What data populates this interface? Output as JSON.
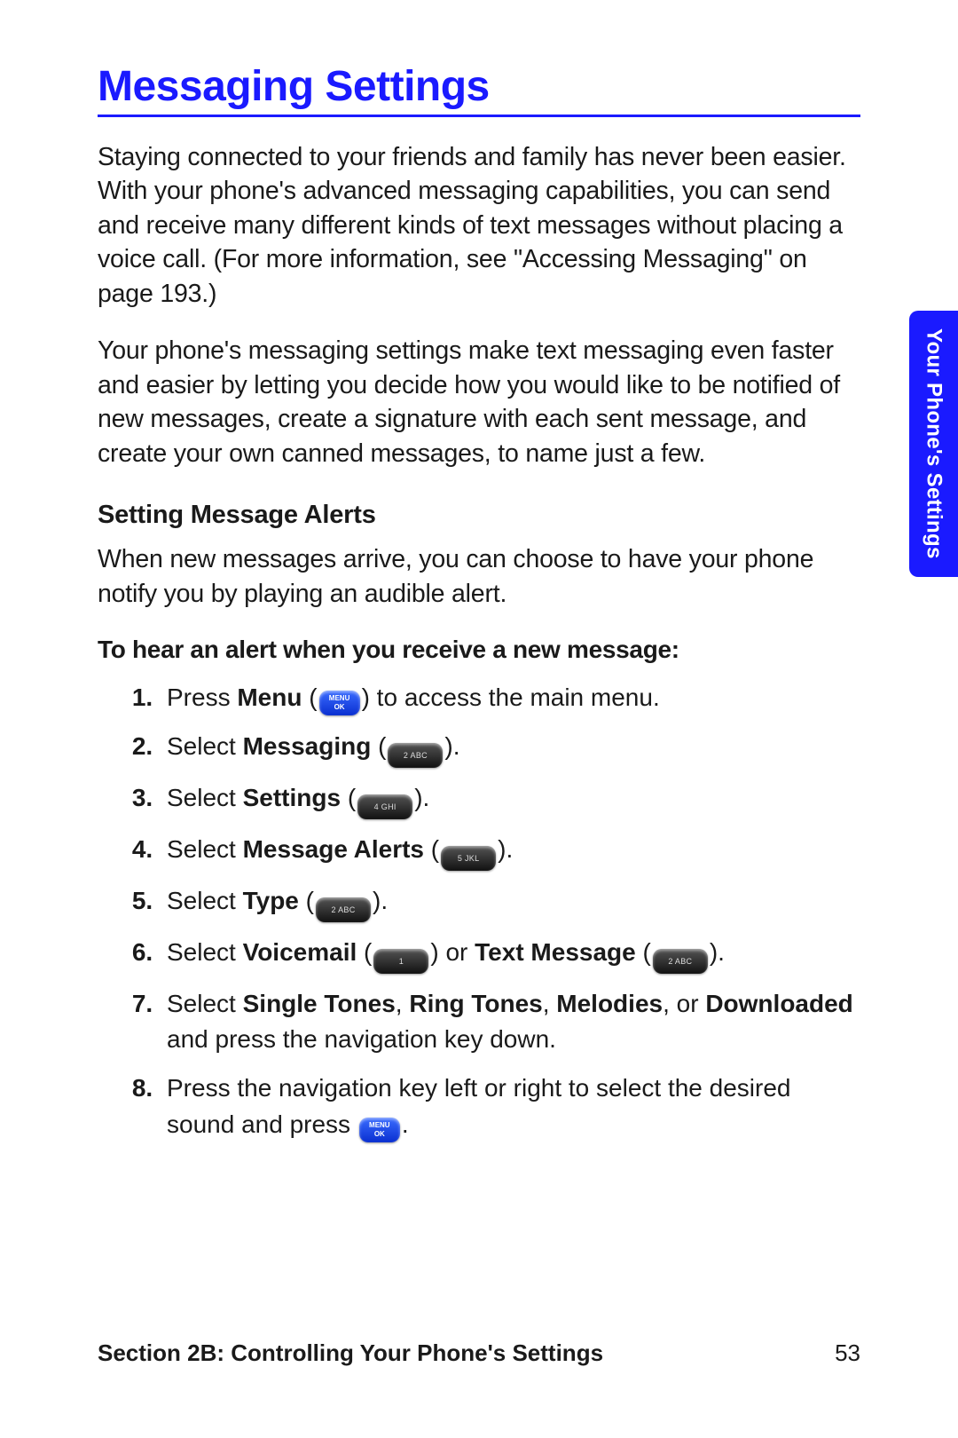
{
  "title": "Messaging Settings",
  "intro1": "Staying connected to your friends and family has never been easier. With your phone's advanced messaging capabilities, you can send and receive many different kinds of text messages without placing a voice call. (For more information, see \"Accessing Messaging\" on page 193.)",
  "intro2": "Your phone's messaging settings make text messaging even faster and easier by letting you decide how you would like to be notified of new messages, create a signature with each sent message, and create your own canned messages, to name just a few.",
  "subheading": "Setting Message Alerts",
  "sub_para": "When new messages arrive, you can choose to have your phone notify you by playing an audible alert.",
  "lead_in": "To hear an alert when you receive a new message:",
  "steps": {
    "s1a": "Press ",
    "s1b": "Menu",
    "s1c": " (",
    "s1d": ") to access the main menu.",
    "s2a": "Select ",
    "s2b": "Messaging",
    "s2c": " (",
    "s2d": ").",
    "s3a": "Select ",
    "s3b": "Settings",
    "s3c": " (",
    "s3d": ").",
    "s4a": "Select ",
    "s4b": "Message Alerts",
    "s4c": " (",
    "s4d": ").",
    "s5a": "Select ",
    "s5b": "Type",
    "s5c": " (",
    "s5d": ").",
    "s6a": "Select ",
    "s6b": "Voicemail",
    "s6c": " (",
    "s6d": ") or ",
    "s6e": "Text Message",
    "s6f": " (",
    "s6g": ").",
    "s7a": "Select ",
    "s7b": "Single Tones",
    "s7c": ", ",
    "s7d": "Ring Tones",
    "s7e": ", ",
    "s7f": "Melodies",
    "s7g": ", or ",
    "s7h": "Downloaded",
    "s7i": " and press the navigation key down.",
    "s8a": "Press the navigation key left or right to select the desired sound and press ",
    "s8b": "."
  },
  "keys": {
    "menu_line1": "MENU",
    "menu_line2": "OK",
    "k1": "1",
    "k2": "2 ABC",
    "k4": "4 GHI",
    "k5": "5 JKL"
  },
  "sidetab": "Your Phone's Settings",
  "footer": {
    "section": "Section 2B: Controlling Your Phone's Settings",
    "page": "53"
  }
}
